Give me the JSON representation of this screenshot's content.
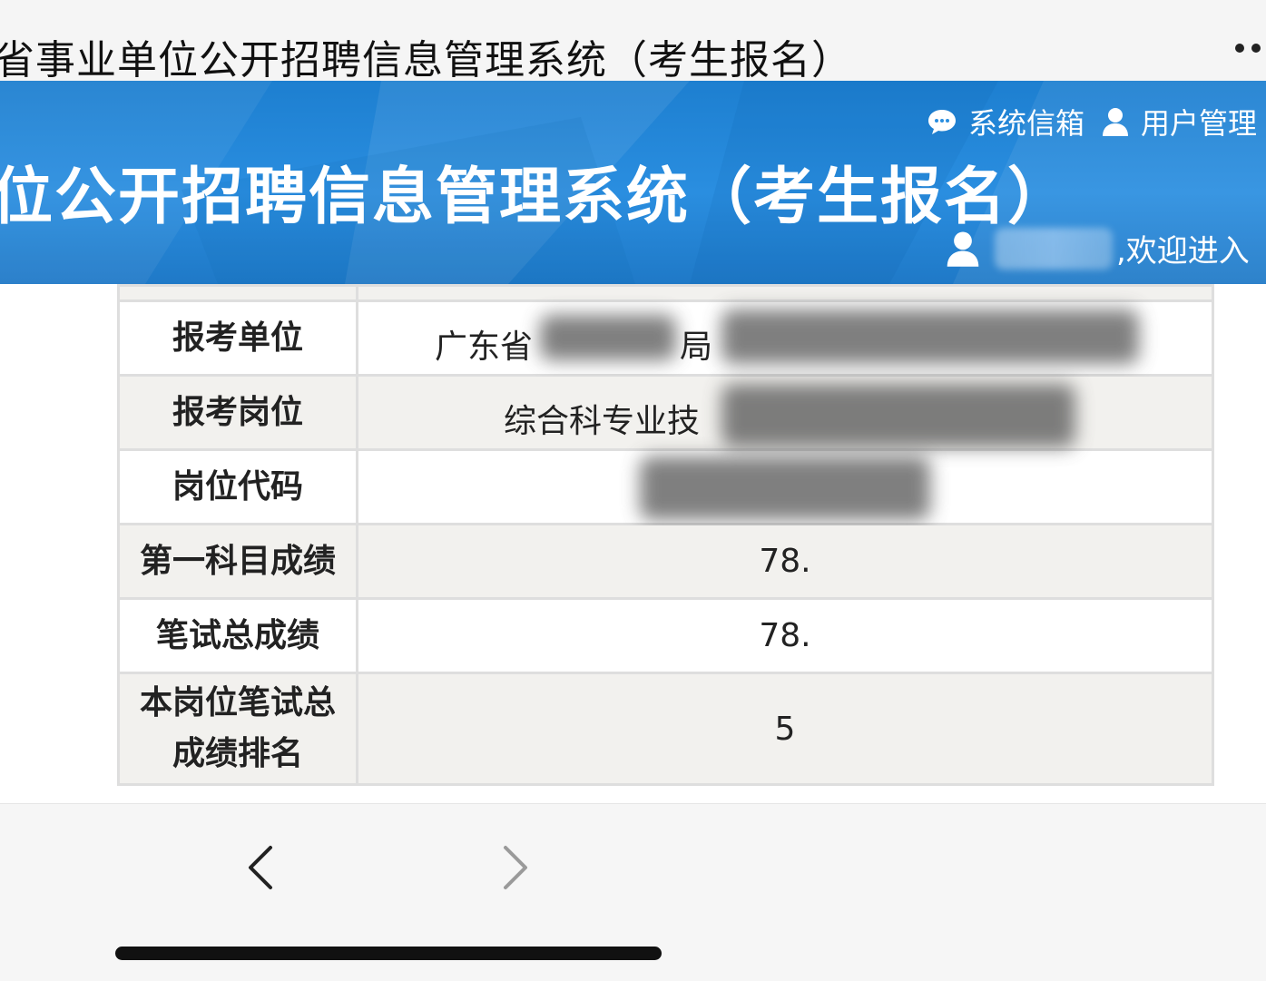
{
  "titlebar": {
    "title": "省事业单位公开招聘信息管理系统（考生报名）"
  },
  "header": {
    "system_name": "位公开招聘信息管理系统（考生报名）",
    "links": [
      {
        "label": "系统信箱",
        "icon": "chat-icon"
      },
      {
        "label": "用户管理",
        "icon": "user-icon"
      }
    ],
    "welcome_text": ",欢迎进入"
  },
  "table": {
    "rows": [
      {
        "label": "报考单位",
        "value": "广东省"
      },
      {
        "label": "报考岗位",
        "value": "综合科专业技"
      },
      {
        "label": "岗位代码",
        "value": ""
      },
      {
        "label": "第一科目成绩",
        "value": "78."
      },
      {
        "label": "笔试总成绩",
        "value": "78."
      },
      {
        "label": "本岗位笔试总成绩排名",
        "value": "5"
      }
    ],
    "extra_fragment": "局"
  },
  "nav": {
    "back": "back-arrow-icon",
    "forward": "forward-arrow-icon"
  },
  "colors": {
    "banner": "#2a8ee0",
    "row_alt": "#f2f1ee",
    "border": "#dedede"
  }
}
